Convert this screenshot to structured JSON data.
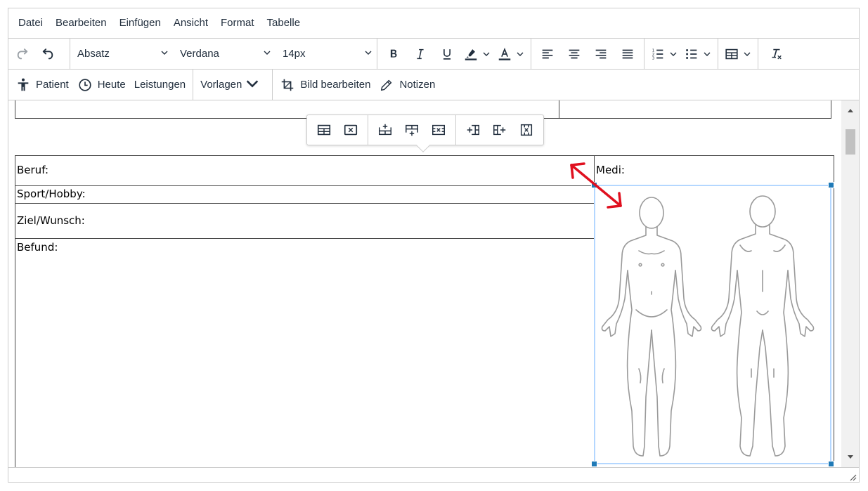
{
  "menubar": {
    "items": [
      "Datei",
      "Bearbeiten",
      "Einfügen",
      "Ansicht",
      "Format",
      "Tabelle"
    ]
  },
  "toolbar": {
    "block_format": "Absatz",
    "font_family": "Verdana",
    "font_size": "14px",
    "icons": [
      "redo-icon",
      "undo-icon",
      "bold-icon",
      "italic-icon",
      "underline-icon",
      "highlight-icon",
      "text-color-icon",
      "align-left-icon",
      "align-center-icon",
      "align-right-icon",
      "align-justify-icon",
      "numbered-list-icon",
      "bullet-list-icon",
      "table-icon",
      "clear-formatting-icon"
    ],
    "highlight_color": "#222f3e",
    "text_color": "#222f3e"
  },
  "custom_toolbar": {
    "patient": "Patient",
    "heute": "Heute",
    "leistungen": "Leistungen",
    "vorlagen": "Vorlagen",
    "bild_bearbeiten": "Bild bearbeiten",
    "notizen": "Notizen"
  },
  "document": {
    "beruf": "Beruf:",
    "medi": "Medi:",
    "sport": "Sport/Hobby:",
    "ziel": "Ziel/Wunsch:",
    "befund": "Befund:"
  },
  "table_toolbar": {
    "icons": [
      "table-properties-icon",
      "delete-table-icon",
      "insert-row-before-icon",
      "insert-row-after-icon",
      "delete-row-icon",
      "insert-column-before-icon",
      "insert-column-after-icon",
      "delete-column-icon"
    ]
  },
  "colors": {
    "selection_border": "#b4d7ff",
    "handle": "#207ab7",
    "annotation_arrow": "#e0101f"
  }
}
